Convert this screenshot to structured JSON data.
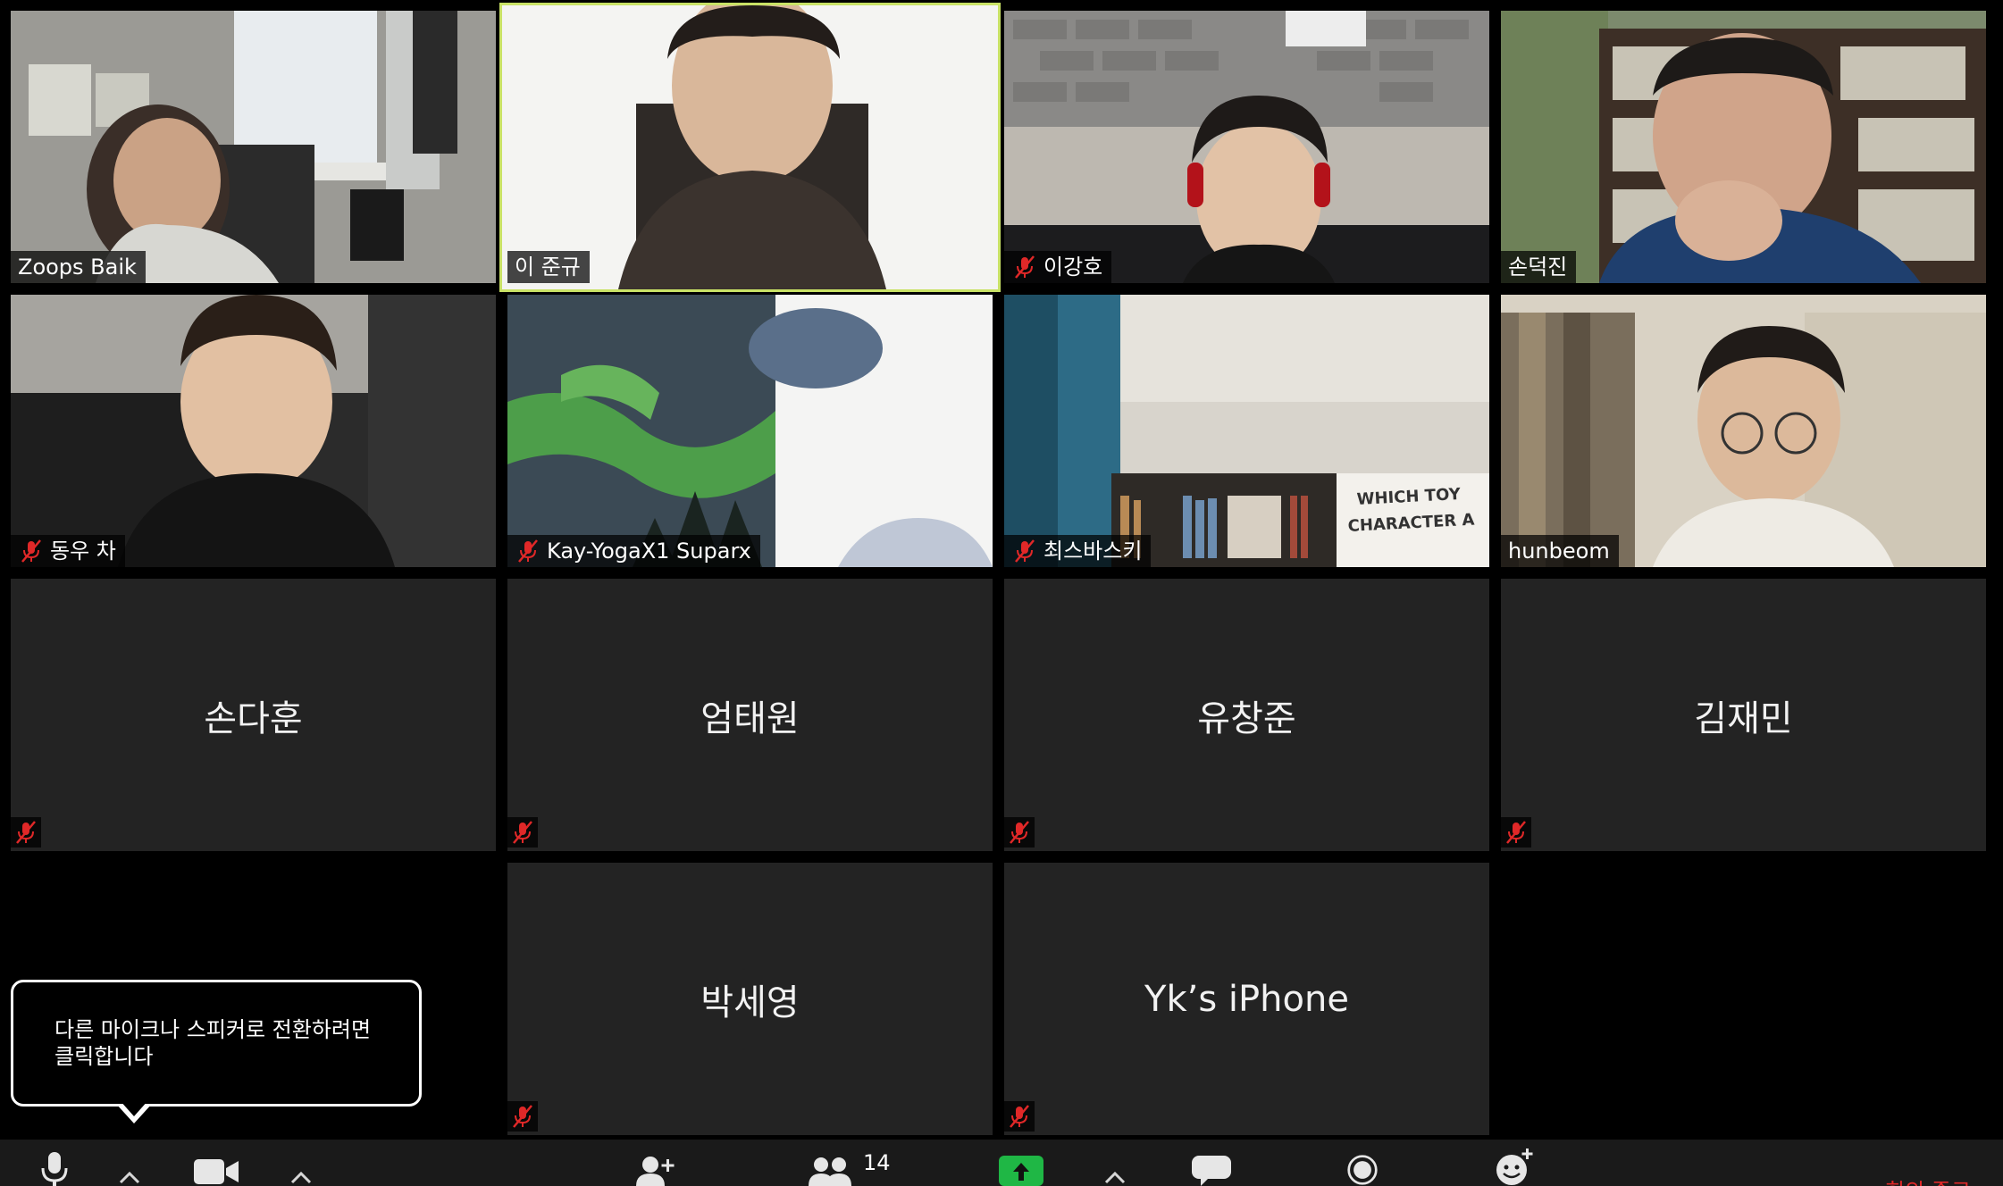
{
  "participants": {
    "row1": [
      {
        "name": "Zoops Baik",
        "muted": false
      },
      {
        "name": "이 준규",
        "muted": false,
        "active_speaker": true
      },
      {
        "name": "이강호",
        "muted": true
      },
      {
        "name": "손덕진",
        "muted": false
      }
    ],
    "row2": [
      {
        "name": "동우 차",
        "muted": true
      },
      {
        "name": "Kay-YogaX1 Suparx",
        "muted": true
      },
      {
        "name": "최스바스키",
        "muted": true
      },
      {
        "name": "hunbeom",
        "muted": false
      }
    ],
    "row3": [
      {
        "name": "손다훈",
        "muted": true
      },
      {
        "name": "엄태원",
        "muted": true
      },
      {
        "name": "유창준",
        "muted": true
      },
      {
        "name": "김재민",
        "muted": true
      }
    ],
    "row4": [
      {
        "name": "박세영",
        "muted": true
      },
      {
        "name": "Yk’s iPhone",
        "muted": true
      }
    ]
  },
  "background_signs": {
    "poster_line1": "WHICH TOY",
    "poster_line2": "CHARACTER A"
  },
  "tooltip": {
    "text_line1": "다른 마이크나 스피커로 전환하려면",
    "text_line2": "클릭합니다"
  },
  "toolbar": {
    "participants_count": "14",
    "end_label": "회의 종료",
    "colors": {
      "share_green": "#1fb745",
      "end_red": "#e02828",
      "active_border": "#c9e266"
    }
  }
}
